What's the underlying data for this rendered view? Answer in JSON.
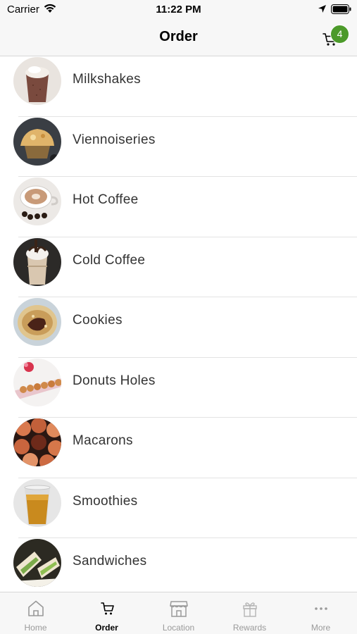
{
  "status_bar": {
    "carrier": "Carrier",
    "time": "11:22 PM"
  },
  "nav": {
    "title": "Order",
    "cart_count": "4",
    "badge_color": "#4c9a2a"
  },
  "categories": [
    {
      "label": "Milkshakes",
      "icon": "milkshake-photo"
    },
    {
      "label": "Viennoiseries",
      "icon": "pastry-photo"
    },
    {
      "label": "Hot Coffee",
      "icon": "hot-coffee-photo"
    },
    {
      "label": "Cold Coffee",
      "icon": "cold-coffee-photo"
    },
    {
      "label": "Cookies",
      "icon": "cookie-photo"
    },
    {
      "label": "Donuts Holes",
      "icon": "donut-holes-photo"
    },
    {
      "label": "Macarons",
      "icon": "macaron-photo"
    },
    {
      "label": "Smoothies",
      "icon": "smoothie-photo"
    },
    {
      "label": "Sandwiches",
      "icon": "sandwich-photo"
    }
  ],
  "tabs": [
    {
      "label": "Home",
      "icon": "home-icon",
      "active": false
    },
    {
      "label": "Order",
      "icon": "cart-icon",
      "active": true
    },
    {
      "label": "Location",
      "icon": "store-icon",
      "active": false
    },
    {
      "label": "Rewards",
      "icon": "gift-icon",
      "active": false
    },
    {
      "label": "More",
      "icon": "more-icon",
      "active": false
    }
  ]
}
